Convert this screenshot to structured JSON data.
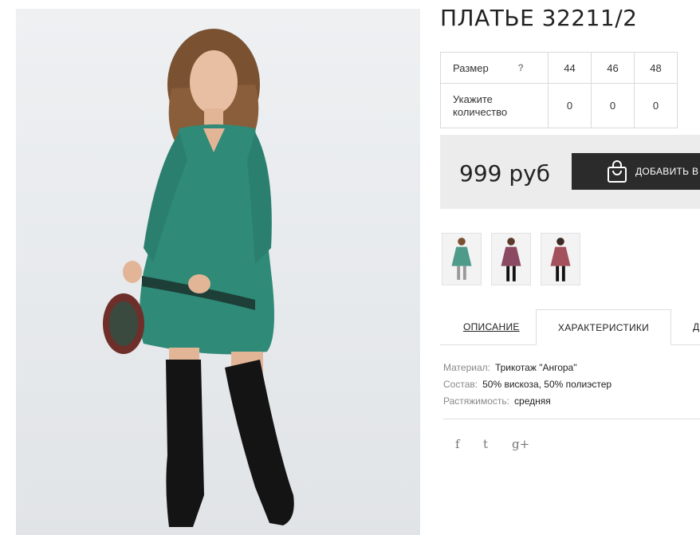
{
  "product": {
    "title": "ПЛАТЬЕ 32211/2"
  },
  "size_table": {
    "size_label": "Размер",
    "help_symbol": "?",
    "sizes": [
      "44",
      "46",
      "48"
    ],
    "quantity_label_line1": "Укажите",
    "quantity_label_line2": "количество",
    "quantities": [
      "0",
      "0",
      "0"
    ]
  },
  "price": {
    "value": "999 руб",
    "add_to_cart_label": "ДОБАВИТЬ В КОРЗИНУ"
  },
  "thumbnails": [
    {
      "color": "#4e9b8a",
      "icon": "dress-thumbnail-green"
    },
    {
      "color": "#8b4a62",
      "icon": "dress-thumbnail-plum"
    },
    {
      "color": "#a3525d",
      "icon": "dress-thumbnail-rose"
    }
  ],
  "tabs": {
    "description": "ОПИСАНИЕ",
    "characteristics": "ХАРАКТЕРИСТИКИ",
    "third": "Д"
  },
  "specs": [
    {
      "key": "Материал:",
      "value": "Трикотаж \"Ангора\""
    },
    {
      "key": "Состав:",
      "value": "50% вискоза, 50% полиэстер"
    },
    {
      "key": "Растяжимость:",
      "value": "средняя"
    }
  ],
  "social": {
    "facebook": "f",
    "twitter": "t",
    "googleplus": "g+"
  },
  "colors": {
    "dress": "#2f8a78",
    "button": "#2b2b2b",
    "price_bg": "#ececec"
  }
}
